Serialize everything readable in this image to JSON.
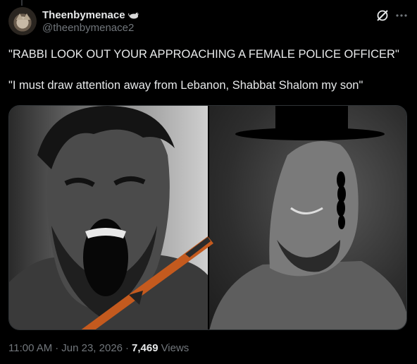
{
  "author": {
    "display_name": "Theenbymenace",
    "handle": "@theenbymenace2",
    "name_emoji_icon": "mouse-emoji-icon"
  },
  "header_actions": {
    "grok_icon": "grok-icon",
    "more_icon": "more-dots-icon"
  },
  "tweet": {
    "text": "\"RABBI LOOK OUT YOUR APPROACHING A FEMALE POLICE OFFICER\"\n\n\"I must draw attention away from Lebanon, Shabbat Shalom my son\""
  },
  "media": {
    "left_image": "screaming-man-with-rifle",
    "right_image": "smiling-man-with-black-hat-and-sidelock"
  },
  "meta": {
    "time": "11:00 AM",
    "separator": "·",
    "date": "Jun 23, 2026",
    "separator2": "·",
    "views_count": "7,469",
    "views_label": "Views"
  },
  "colors": {
    "background": "#000000",
    "text_primary": "#e7e9ea",
    "text_secondary": "#71767b",
    "rifle_stock": "#c45a1e"
  }
}
